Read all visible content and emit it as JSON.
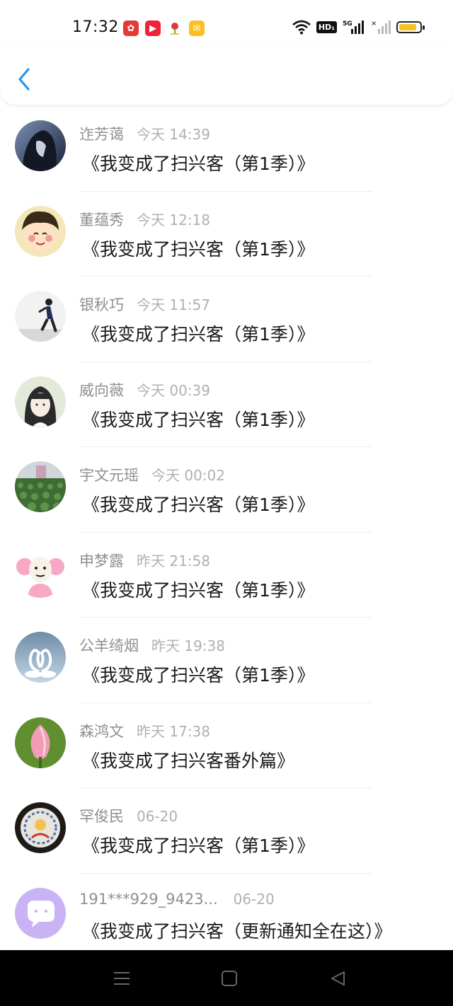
{
  "status_bar": {
    "time": "17:32",
    "hd_label": "HD₁",
    "battery_level": 0.8,
    "app_icons": [
      "flower-app-icon",
      "video-app-icon",
      "map-pin-app-icon",
      "mail-app-icon"
    ]
  },
  "header": {
    "back_icon": "chevron-left-icon"
  },
  "items": [
    {
      "name": "迮芳蔼",
      "time": "今天 14:39",
      "message": "《我变成了扫兴客（第1季）》",
      "avatar": "avatar-dark-hair"
    },
    {
      "name": "董蕴秀",
      "time": "今天 12:18",
      "message": "《我变成了扫兴客（第1季）》",
      "avatar": "avatar-cartoon-girl"
    },
    {
      "name": "银秋巧",
      "time": "今天 11:57",
      "message": "《我变成了扫兴客（第1季）》",
      "avatar": "avatar-runner"
    },
    {
      "name": "威向薇",
      "time": "今天 00:39",
      "message": "《我变成了扫兴客（第1季）》",
      "avatar": "avatar-girl-portrait"
    },
    {
      "name": "宇文元瑶",
      "time": "今天 00:02",
      "message": "《我变成了扫兴客（第1季）》",
      "avatar": "avatar-field"
    },
    {
      "name": "申梦露",
      "time": "昨天 21:58",
      "message": "《我变成了扫兴客（第1季）》",
      "avatar": "avatar-meme-pink"
    },
    {
      "name": "公羊绮烟",
      "time": "昨天 19:38",
      "message": "《我变成了扫兴客（第1季）》",
      "avatar": "avatar-swans"
    },
    {
      "name": "森鸿文",
      "time": "昨天 17:38",
      "message": "《我变成了扫兴客番外篇》",
      "avatar": "avatar-lotus"
    },
    {
      "name": "罕俊民",
      "time": "06-20",
      "message": "《我变成了扫兴客（第1季）》",
      "avatar": "avatar-ornament"
    },
    {
      "name": "191***929_9423...",
      "time": "06-20",
      "message": "《我变成了扫兴客（更新通知全在这）》",
      "avatar": "avatar-chat-bubble"
    }
  ],
  "nav_bar": {
    "icons": [
      "menu-icon",
      "home-icon",
      "back-triangle-icon"
    ]
  },
  "colors": {
    "accent": "#2196f3",
    "name": "#8f8f8f",
    "time": "#b0b0b0",
    "message": "#1a1a1a"
  }
}
